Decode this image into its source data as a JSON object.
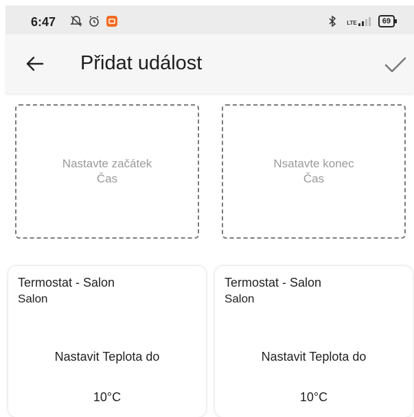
{
  "status_bar": {
    "time": "6:47",
    "battery": "69",
    "network": "LTE",
    "icons_left": [
      "muted-notification-icon",
      "alarm-icon",
      "app-notification-icon"
    ],
    "icons_right": [
      "bluetooth-icon",
      "signal-icon",
      "battery-icon"
    ]
  },
  "app_bar": {
    "title": "Přidat událost",
    "back_icon": "back-arrow-icon",
    "confirm_icon": "check-icon"
  },
  "time_pickers": {
    "start": {
      "line1": "Nastavte začátek",
      "line2": "Čas"
    },
    "end": {
      "line1": "Nsatavte konec",
      "line2": "Čas"
    }
  },
  "cards": [
    {
      "device": "Termostat - Salon",
      "room": "Salon",
      "action": "Nastavit Teplota do",
      "value": "10°C"
    },
    {
      "device": "Termostat - Salon",
      "room": "Salon",
      "action": "Nastavit Teplota do",
      "value": "10°C"
    }
  ],
  "colors": {
    "statusbar_bg": "#ececec",
    "appbar_bg": "#f6f6f6",
    "placeholder_text": "#9a9a9a",
    "accent_orange": "#f26b21"
  }
}
